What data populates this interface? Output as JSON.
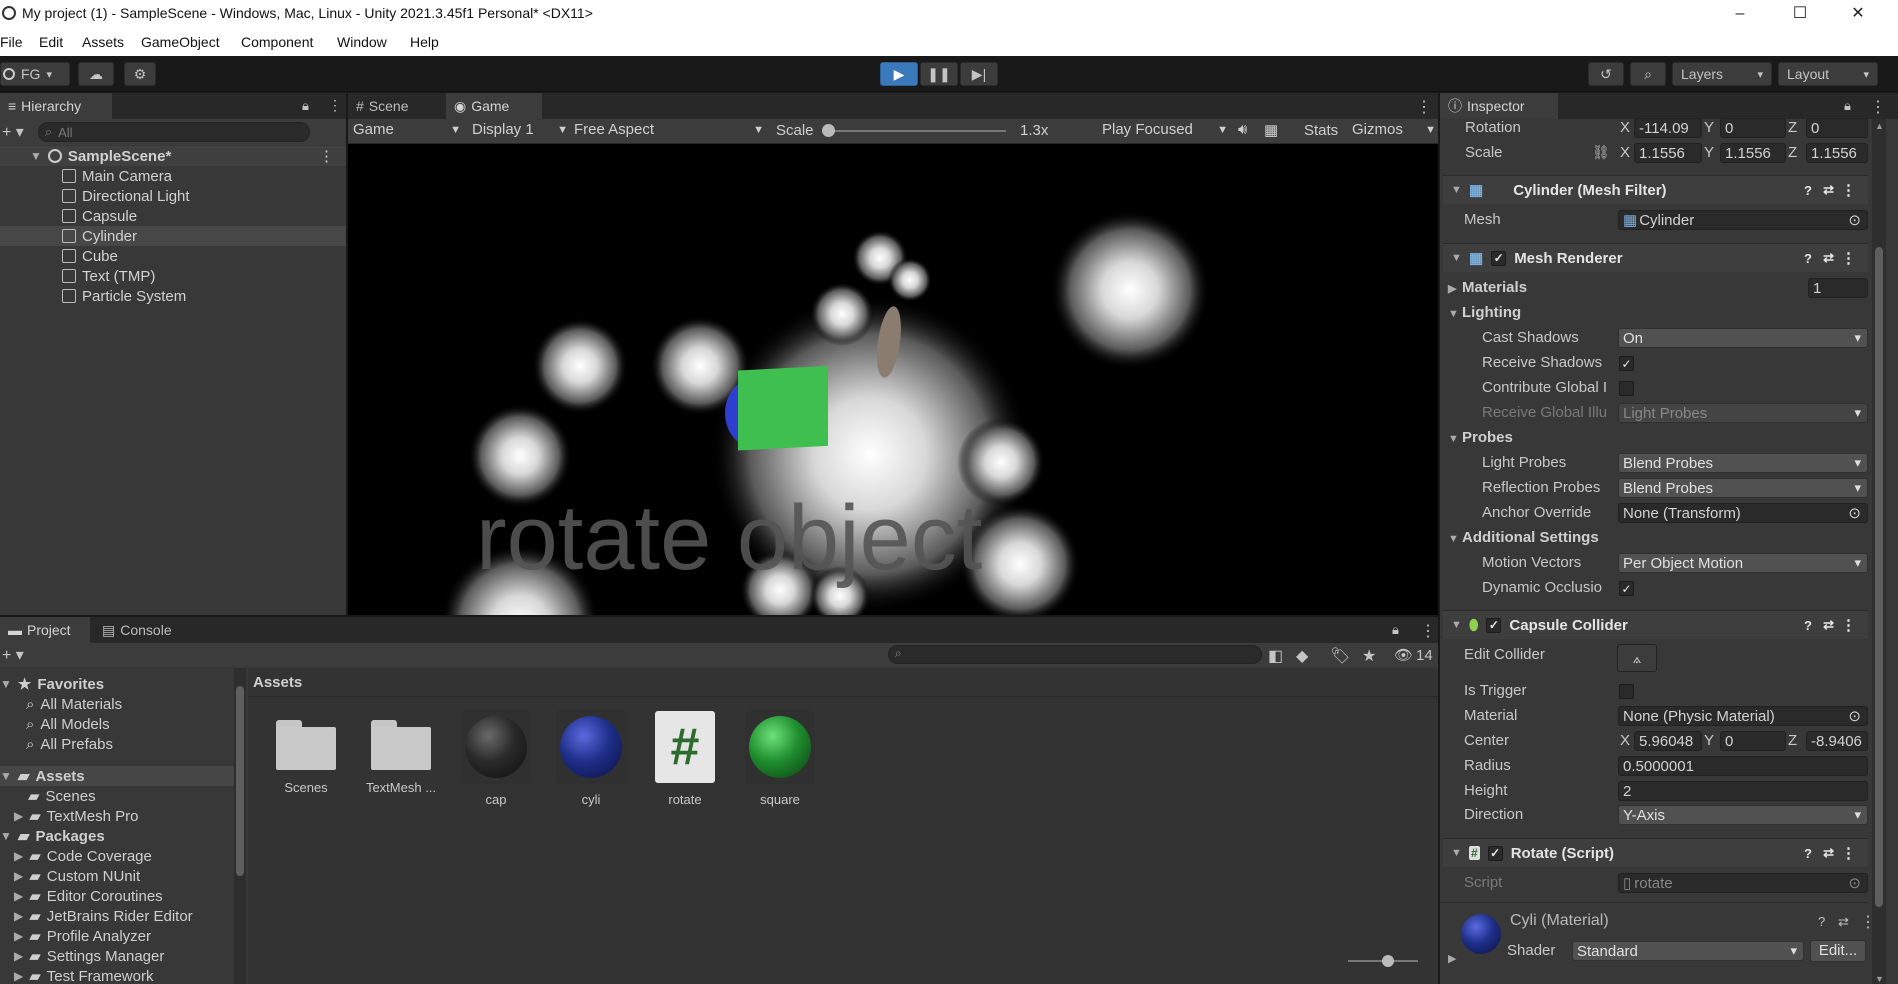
{
  "window": {
    "title": "My project (1) - SampleScene - Windows, Mac, Linux - Unity 2021.3.45f1 Personal* <DX11>"
  },
  "menu": [
    "File",
    "Edit",
    "Assets",
    "GameObject",
    "Component",
    "Window",
    "Help"
  ],
  "toolbar": {
    "account": "FG",
    "layers": "Layers",
    "layout": "Layout"
  },
  "hierarchy": {
    "tab": "Hierarchy",
    "search_placeholder": "All",
    "scene": "SampleScene*",
    "items": [
      "Main Camera",
      "Directional Light",
      "Capsule",
      "Cylinder",
      "Cube",
      "Text (TMP)",
      "Particle System"
    ],
    "selected": "Cylinder"
  },
  "view_tabs": {
    "scene": "Scene",
    "game": "Game"
  },
  "game_toolbar": {
    "mode": "Game",
    "display": "Display 1",
    "aspect": "Free Aspect",
    "scale_label": "Scale",
    "scale_value": "1.3x",
    "play_mode": "Play Focused",
    "stats": "Stats",
    "gizmos": "Gizmos"
  },
  "game_view": {
    "overlay_text": "rotate object"
  },
  "project": {
    "tabs": {
      "project": "Project",
      "console": "Console"
    },
    "hidden_count": "14",
    "favorites_header": "Favorites",
    "favorites": [
      "All Materials",
      "All Models",
      "All Prefabs"
    ],
    "assets_header": "Assets",
    "asset_folders": [
      "Scenes",
      "TextMesh Pro"
    ],
    "packages_header": "Packages",
    "packages": [
      "Code Coverage",
      "Custom NUnit",
      "Editor Coroutines",
      "JetBrains Rider Editor",
      "Profile Analyzer",
      "Settings Manager",
      "Test Framework"
    ],
    "breadcrumb": "Assets",
    "assets": [
      {
        "name": "Scenes",
        "kind": "folder"
      },
      {
        "name": "TextMesh ...",
        "kind": "folder"
      },
      {
        "name": "cap",
        "kind": "material",
        "color": "#2a2a2a"
      },
      {
        "name": "cyli",
        "kind": "material",
        "color": "#1f2f8a"
      },
      {
        "name": "rotate",
        "kind": "script"
      },
      {
        "name": "square",
        "kind": "material",
        "color": "#1f8f2f"
      }
    ]
  },
  "inspector": {
    "tab": "Inspector",
    "transform": {
      "rotation_label": "Rotation",
      "rot_x": "-114.09",
      "rot_y": "0",
      "rot_z": "0",
      "scale_label": "Scale",
      "scale_x": "1.1556",
      "scale_y": "1.1556",
      "scale_z": "1.1556"
    },
    "axes": {
      "x": "X",
      "y": "Y",
      "z": "Z"
    },
    "mesh_filter": {
      "title": "Cylinder (Mesh Filter)",
      "mesh_label": "Mesh",
      "mesh_value": "Cylinder"
    },
    "mesh_renderer": {
      "title": "Mesh Renderer",
      "materials_label": "Materials",
      "materials_count": "1",
      "lighting": "Lighting",
      "cast_shadows_label": "Cast Shadows",
      "cast_shadows": "On",
      "receive_shadows_label": "Receive Shadows",
      "contribute_gi_label": "Contribute Global I",
      "receive_gi_label": "Receive Global Illu",
      "receive_gi": "Light Probes",
      "probes": "Probes",
      "light_probes_label": "Light Probes",
      "light_probes": "Blend Probes",
      "reflection_probes_label": "Reflection Probes",
      "reflection_probes": "Blend Probes",
      "anchor_override_label": "Anchor Override",
      "anchor_override": "None (Transform)",
      "additional": "Additional Settings",
      "motion_vectors_label": "Motion Vectors",
      "motion_vectors": "Per Object Motion",
      "dynamic_occlusion_label": "Dynamic Occlusio"
    },
    "capsule_collider": {
      "title": "Capsule Collider",
      "edit_collider_label": "Edit Collider",
      "is_trigger_label": "Is Trigger",
      "material_label": "Material",
      "material": "None (Physic Material)",
      "center_label": "Center",
      "center_x": "5.96048",
      "center_y": "0",
      "center_z": "-8.9406",
      "radius_label": "Radius",
      "radius": "0.5000001",
      "height_label": "Height",
      "height": "2",
      "direction_label": "Direction",
      "direction": "Y-Axis"
    },
    "rotate_script": {
      "title": "Rotate (Script)",
      "script_label": "Script",
      "script": "rotate"
    },
    "material": {
      "title": "Cyli (Material)",
      "shader_label": "Shader",
      "shader": "Standard",
      "edit": "Edit..."
    }
  }
}
